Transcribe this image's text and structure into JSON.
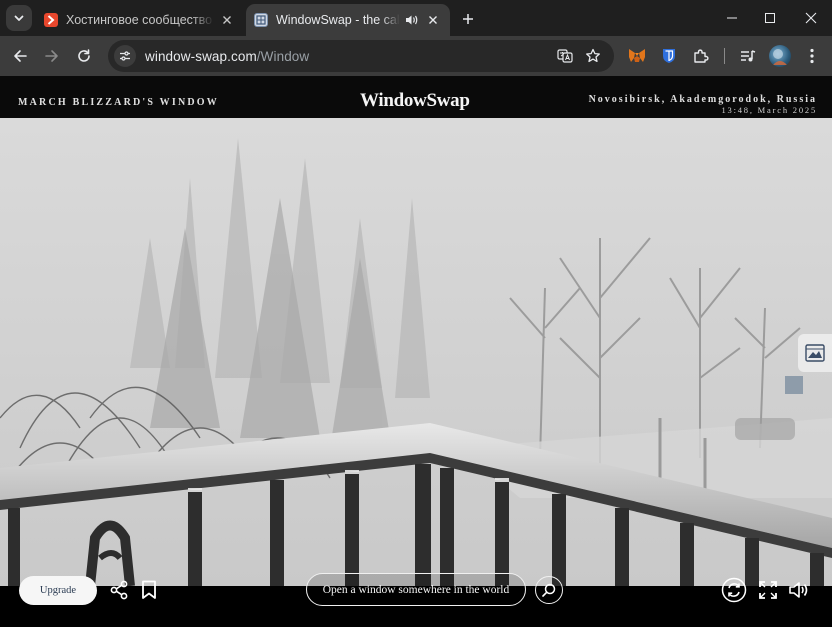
{
  "browser": {
    "tabs": [
      {
        "title": "Хостинговое сообщество «Timeweb»",
        "favicon": "timeweb-icon",
        "active": false
      },
      {
        "title": "WindowSwap - the calmest website",
        "favicon": "windowswap-icon",
        "active": true,
        "audio": true
      }
    ],
    "url": {
      "domain": "window-swap.com",
      "path": "/Window"
    },
    "accent": "#3c3c3c"
  },
  "site": {
    "owner": "March Blizzard's Window",
    "logo": "WindowSwap",
    "location": "Novosibirsk, Akademgorodok, Russia",
    "time": "13:48, March 2025"
  },
  "controls": {
    "upgrade_label": "Upgrade",
    "search_label": "Open a window somewhere in the world"
  }
}
